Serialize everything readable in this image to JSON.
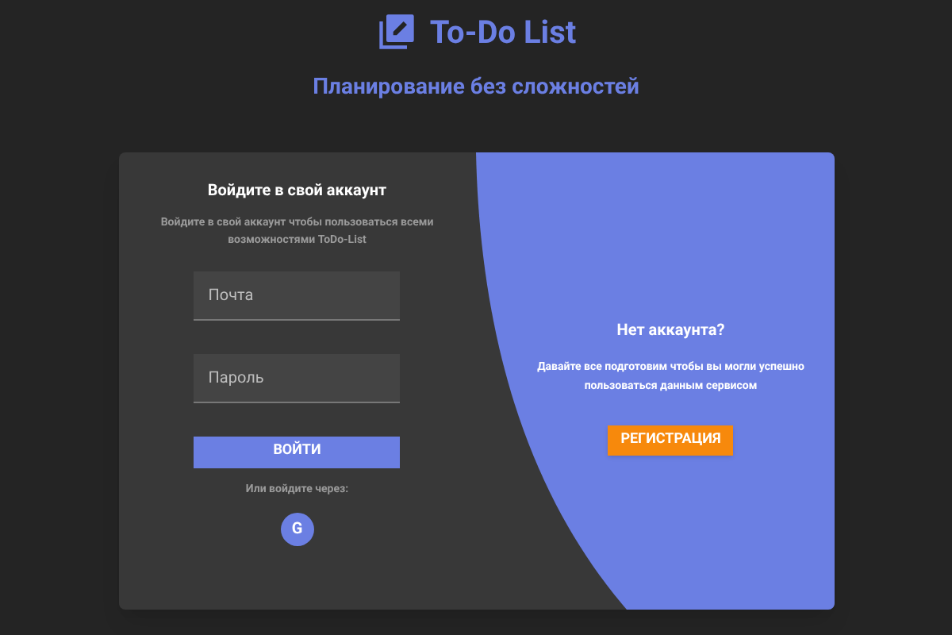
{
  "header": {
    "title": "To-Do List",
    "subtitle": "Планирование без сложностей"
  },
  "login": {
    "title": "Войдите в свой аккаунт",
    "description": "Войдите в свой аккаунт чтобы пользоваться всеми возможностями ToDo-List",
    "fields": [
      {
        "placeholder": "Почта"
      },
      {
        "placeholder": "Пароль"
      }
    ],
    "submit": "ВОЙТИ",
    "alt_text": "Или войдите через:",
    "social_button": "G"
  },
  "signup": {
    "title": "Нет аккаунта?",
    "description": "Давайте все подготовим чтобы вы могли успешно пользоваться данным сервисом",
    "button": "РЕГИСТРАЦИЯ"
  }
}
